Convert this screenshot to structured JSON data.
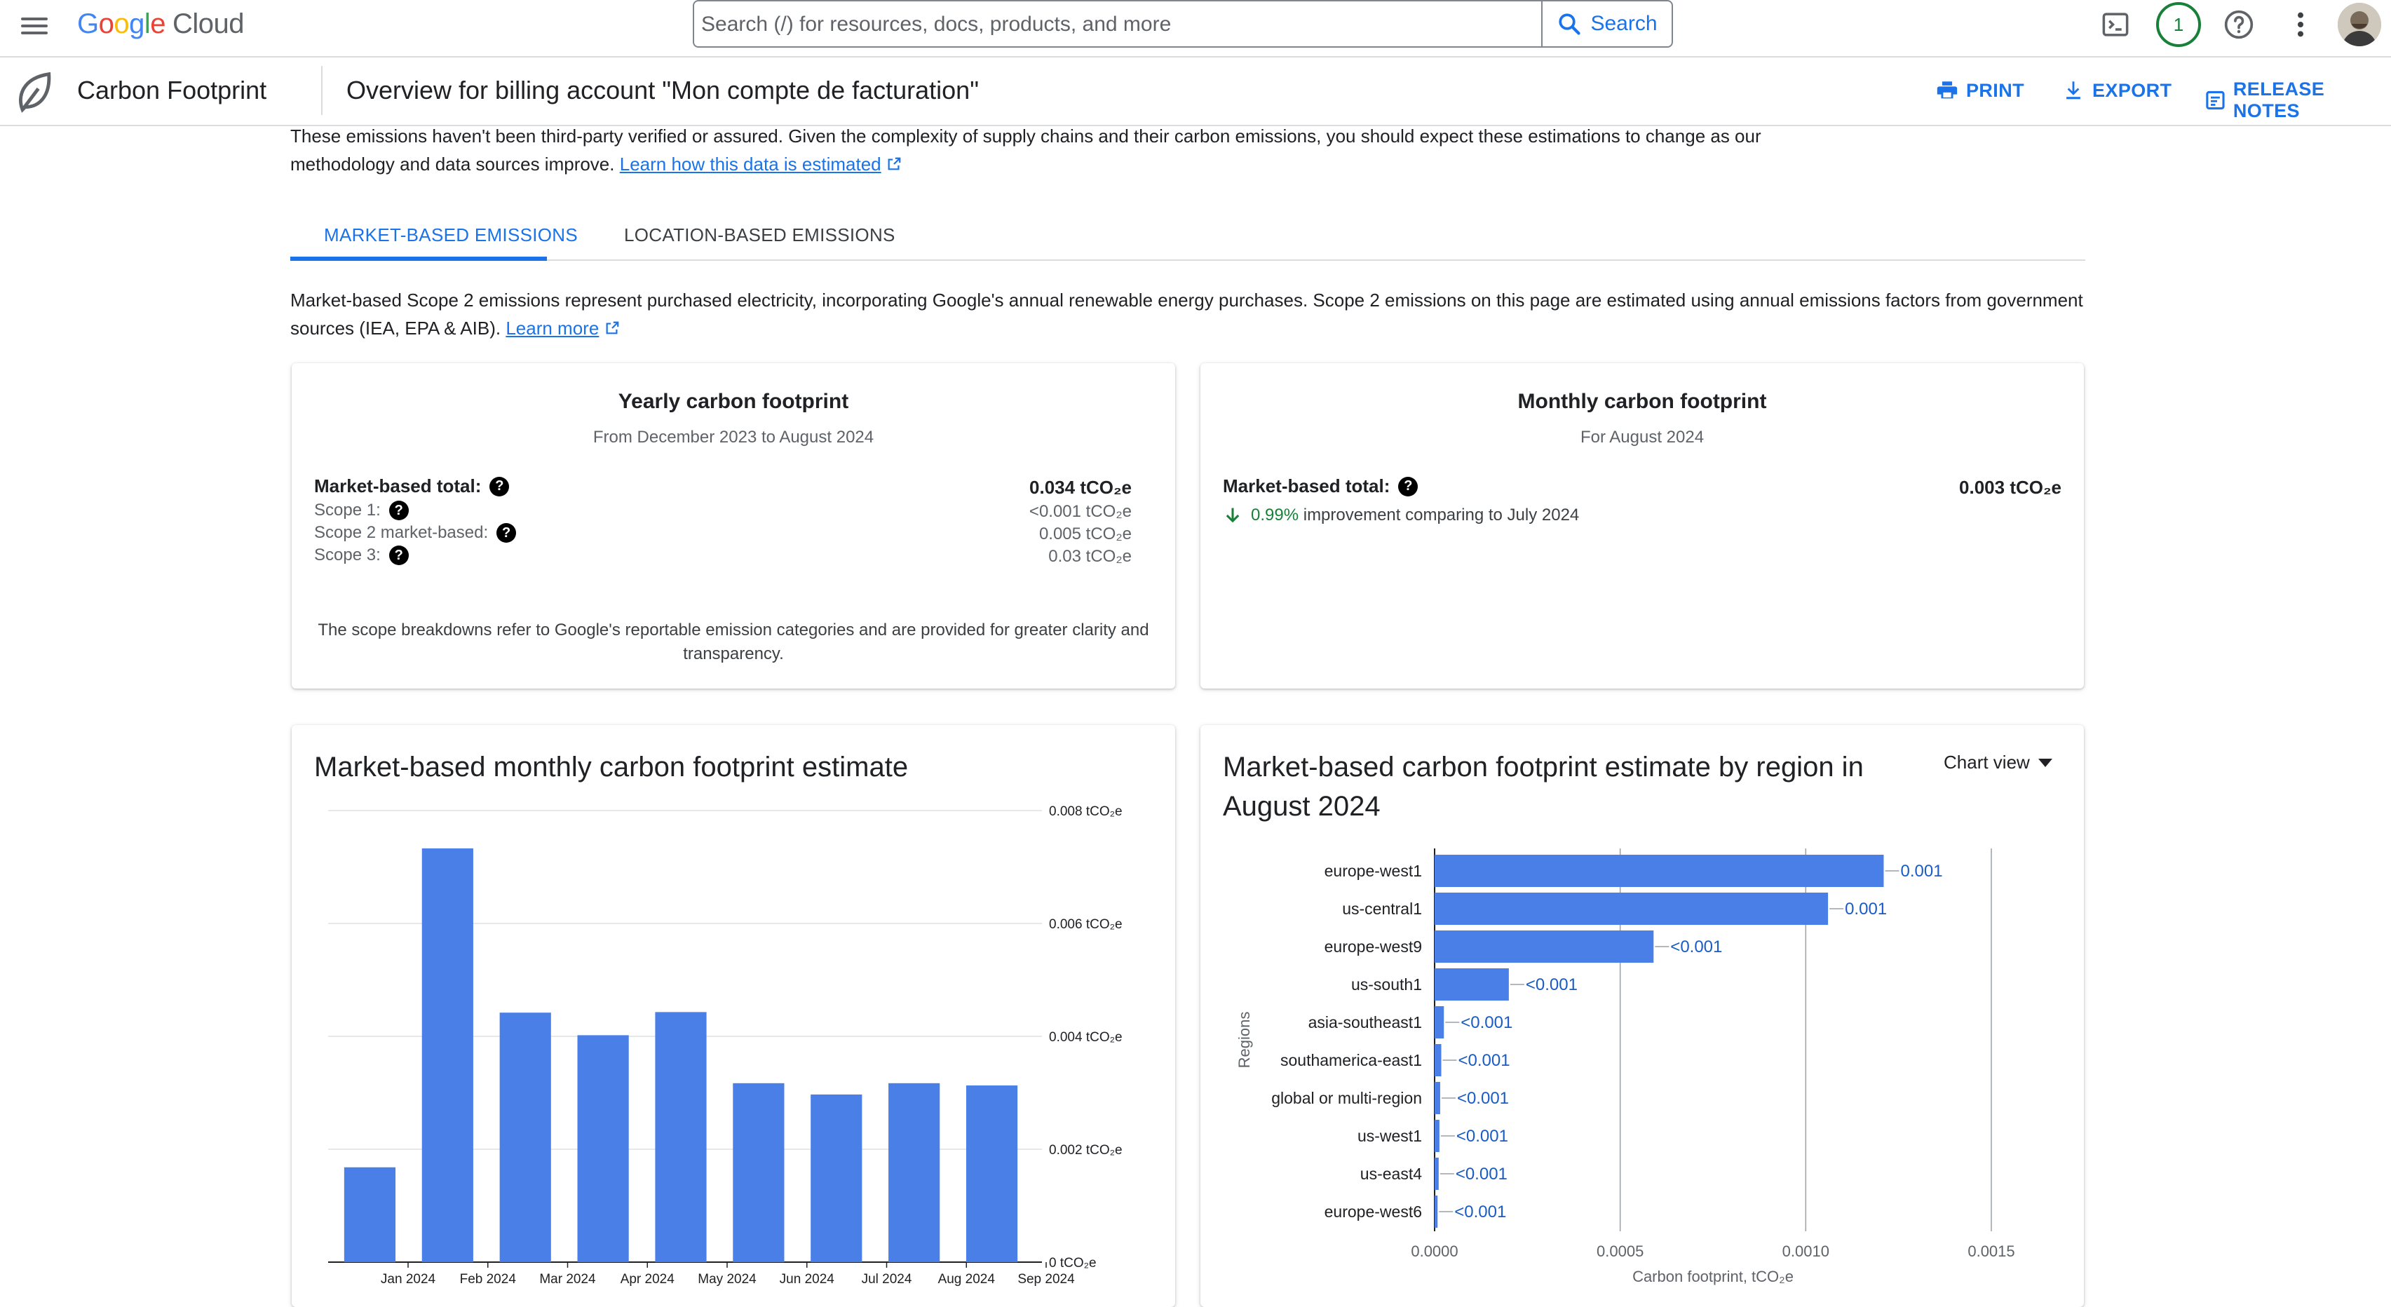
{
  "topbar": {
    "logo_google": "Google",
    "logo_cloud": "Cloud",
    "search_placeholder": "Search (/) for resources, docs, products, and more",
    "search_button": "Search",
    "notifications_count": "1"
  },
  "subheader": {
    "product_name": "Carbon Footprint",
    "page_title": "Overview for billing account \"Mon compte de facturation\"",
    "print": "PRINT",
    "export": "EXPORT",
    "release_notes": "RELEASE NOTES"
  },
  "disclaimer": {
    "text_line1": "These emissions haven't been third-party verified or assured. Given the complexity of supply chains and their carbon emissions, you should expect these estimations to change as our",
    "text_line2": "methodology and data sources improve.",
    "link": "Learn how this data is estimated"
  },
  "tabs": [
    {
      "label": "MARKET-BASED EMISSIONS",
      "active": true
    },
    {
      "label": "LOCATION-BASED EMISSIONS",
      "active": false
    }
  ],
  "tab_description": {
    "text_line1": "Market-based Scope 2 emissions represent purchased electricity, incorporating Google's annual renewable energy purchases. Scope 2 emissions on this page are estimated using annual emissions factors from government",
    "text_line2": "sources (IEA, EPA & AIB).",
    "link": "Learn more"
  },
  "yearly_card": {
    "title": "Yearly carbon footprint",
    "subtitle": "From December 2023 to August 2024",
    "total_label": "Market-based total:",
    "total_value": "0.034 tCO₂e",
    "scope1_label": "Scope 1:",
    "scope1_value": "<0.001 tCO₂e",
    "scope2_label": "Scope 2 market-based:",
    "scope2_value": "0.005 tCO₂e",
    "scope3_label": "Scope 3:",
    "scope3_value": "0.03 tCO₂e",
    "note_line1": "The scope breakdowns refer to Google's reportable emission categories and are provided for greater clarity and",
    "note_line2": "transparency."
  },
  "monthly_card": {
    "title": "Monthly carbon footprint",
    "subtitle": "For August 2024",
    "total_label": "Market-based total:",
    "total_value": "0.003 tCO₂e",
    "improvement_pct": "0.99%",
    "improvement_text": "improvement comparing to July 2024"
  },
  "monthly_chart": {
    "title": "Market-based monthly carbon footprint estimate"
  },
  "region_chart": {
    "title_line1": "Market-based carbon footprint estimate by region in",
    "title_line2": "August 2024",
    "view_toggle": "Chart view"
  },
  "chart_data": [
    {
      "type": "bar",
      "title": "Market-based monthly carbon footprint estimate",
      "categories": [
        "Jan 2024",
        "Feb 2024",
        "Mar 2024",
        "Apr 2024",
        "May 2024",
        "Jun 2024",
        "Jul 2024",
        "Aug 2024",
        "Sep 2024"
      ],
      "values": [
        0.00168,
        0.00733,
        0.00442,
        0.00402,
        0.00443,
        0.00317,
        0.00297,
        0.00317,
        0.00313
      ],
      "y_ticks": [
        "0.008 tCO₂e",
        "0.006 tCO₂e",
        "0.004 tCO₂e",
        "0.002 tCO₂e",
        "0 tCO₂e"
      ],
      "ylim": [
        0,
        0.008
      ],
      "grid": true
    },
    {
      "type": "bar",
      "orientation": "horizontal",
      "title": "Market-based carbon footprint estimate by region in August 2024",
      "xlabel": "Carbon footprint, tCO₂e",
      "ylabel": "Regions",
      "categories": [
        "europe-west1",
        "us-central1",
        "europe-west9",
        "us-south1",
        "asia-southeast1",
        "southamerica-east1",
        "global or multi-region",
        "us-west1",
        "us-east4",
        "europe-west6"
      ],
      "values": [
        0.00121,
        0.00106,
        0.00059,
        0.0002,
        2.5e-05,
        1.8e-05,
        1.5e-05,
        1.3e-05,
        1.1e-05,
        8e-06
      ],
      "data_labels": [
        "0.001",
        "0.001",
        "<0.001",
        "<0.001",
        "<0.001",
        "<0.001",
        "<0.001",
        "<0.001",
        "<0.001",
        "<0.001"
      ],
      "x_ticks": [
        "0.0000",
        "0.0005",
        "0.0010",
        "0.0015"
      ],
      "xlim": [
        0,
        0.0015
      ],
      "grid": true
    }
  ],
  "colors": {
    "accent": "#1a73e8",
    "bar": "#4a7fe8",
    "positive": "#188038"
  }
}
